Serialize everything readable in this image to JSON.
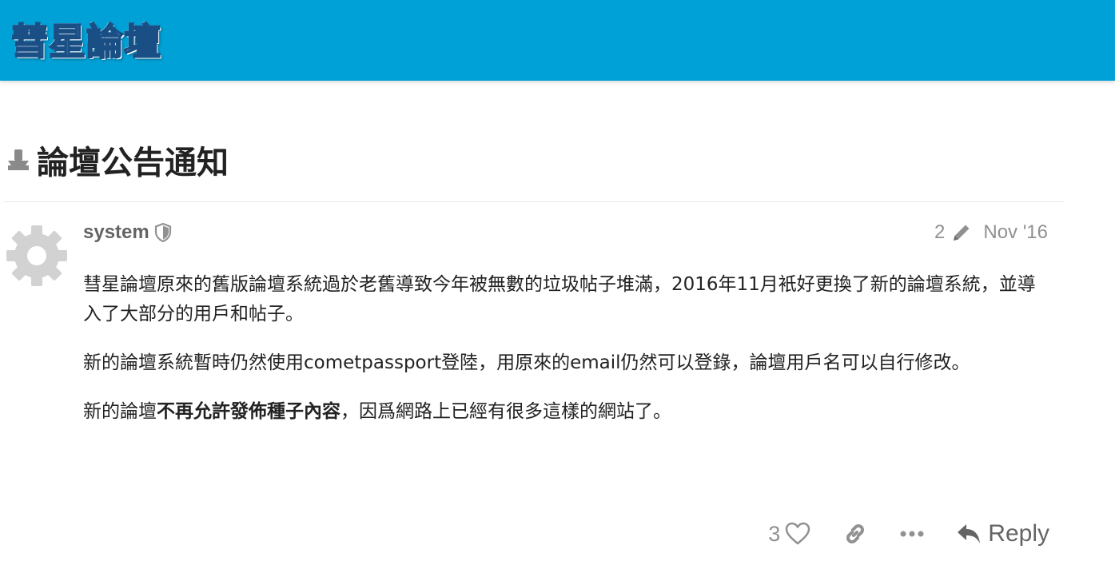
{
  "site": {
    "logo_text": "彗星論壇",
    "header_color": "#00a1d6"
  },
  "topic": {
    "title": "論壇公告通知",
    "pinned_icon": "pin-icon"
  },
  "post": {
    "username": "system",
    "user_badge_icon": "shield-icon",
    "avatar_icon": "gear-icon",
    "edit_count": "2",
    "edit_icon": "pencil-icon",
    "date": "Nov '16",
    "paragraphs": {
      "p1": "彗星論壇原來的舊版論壇系統過於老舊導致今年被無數的垃圾帖子堆滿，2016年11月衹好更換了新的論壇系統，並導入了大部分的用戶和帖子。",
      "p2": "新的論壇系統暫時仍然使用cometpassport登陸，用原來的email仍然可以登錄，論壇用戶名可以自行修改。",
      "p3_prefix": "新的論壇",
      "p3_bold": "不再允許發佈種子內容",
      "p3_suffix": "，因爲網路上已經有很多這樣的網站了。"
    }
  },
  "actions": {
    "like_count": "3",
    "like_icon": "heart-icon",
    "link_icon": "link-icon",
    "more_icon": "more-icon",
    "reply_icon": "reply-icon",
    "reply_label": "Reply"
  }
}
